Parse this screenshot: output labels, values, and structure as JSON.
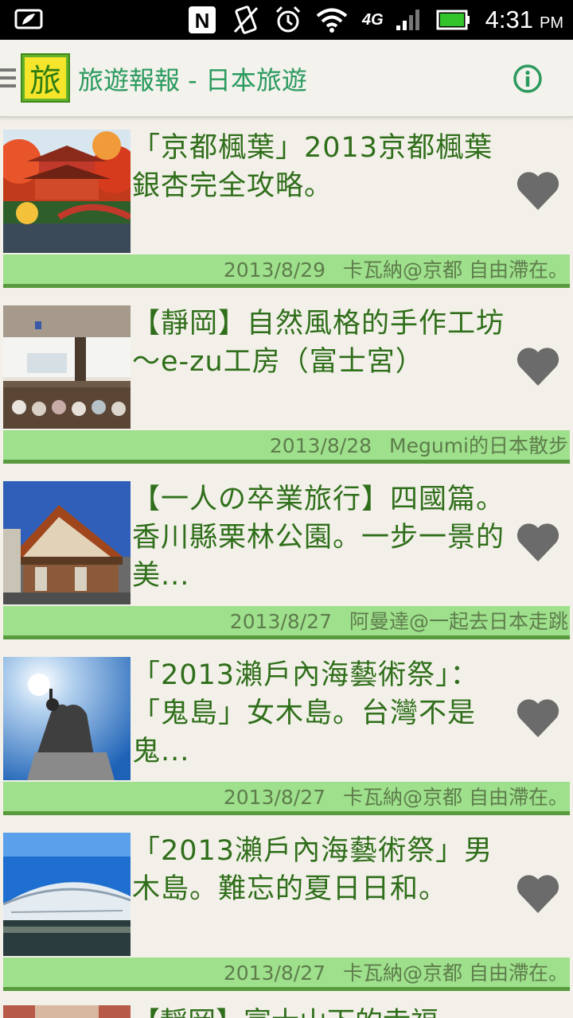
{
  "status_bar": {
    "time": "4:31",
    "ampm": "PM",
    "network": "4G",
    "icons": [
      "screenshot-icon",
      "nfc-icon",
      "vibrate-icon",
      "alarm-icon",
      "wifi-icon",
      "signal-icon",
      "battery-icon"
    ]
  },
  "app_bar": {
    "logo_char": "旅",
    "title": "旅遊報報 - 日本旅遊",
    "info_icon": "info-icon"
  },
  "colors": {
    "accent": "#2a9a5e",
    "meta_bg": "#9ee08c",
    "meta_border": "#5a9a3f",
    "title_text": "#2f6e1a",
    "heart": "#6b6b6b"
  },
  "articles": [
    {
      "title": "「京都楓葉」2013京都楓葉銀杏完全攻略。",
      "date": "2013/8/29",
      "author": "卡瓦納@京都 自由滯在。"
    },
    {
      "title": "【靜岡】自然風格的手作工坊～e-zu工房（富士宮）",
      "date": "2013/8/28",
      "author": "Megumi的日本散步"
    },
    {
      "title": "【一人の卒業旅行】四國篇。香川縣栗林公園。一步一景的美...",
      "date": "2013/8/27",
      "author": "阿曼達@一起去日本走跳"
    },
    {
      "title": "「2013瀨戶內海藝術祭」：「鬼島」女木島。台灣不是鬼...",
      "date": "2013/8/27",
      "author": "卡瓦納@京都 自由滯在。"
    },
    {
      "title": "「2013瀨戶內海藝術祭」男木島。難忘的夏日日和。",
      "date": "2013/8/27",
      "author": "卡瓦納@京都 自由滯在。"
    }
  ],
  "partial_article": {
    "title": "【靜岡】富士山下的幸福"
  }
}
